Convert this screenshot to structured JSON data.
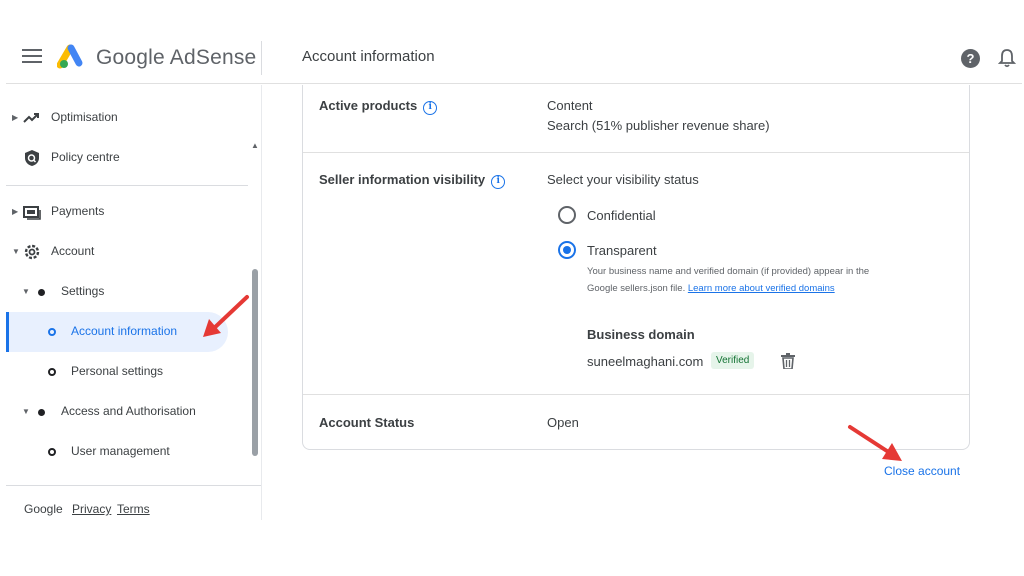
{
  "header": {
    "brand": "Google AdSense",
    "page_title": "Account information",
    "help_glyph": "?"
  },
  "sidebar": {
    "items": [
      {
        "label": "Optimisation",
        "icon": "trending-up-icon"
      },
      {
        "label": "Policy centre",
        "icon": "policy-shield-icon"
      },
      {
        "label": "Payments",
        "icon": "payments-icon"
      },
      {
        "label": "Account",
        "icon": "gear-icon"
      },
      {
        "label": "Settings"
      },
      {
        "label": "Account information",
        "active": true
      },
      {
        "label": "Personal settings"
      },
      {
        "label": "Access and Authorisation"
      },
      {
        "label": "User management"
      }
    ],
    "footer": {
      "google": "Google",
      "privacy": "Privacy",
      "terms": "Terms"
    }
  },
  "main": {
    "active_products": {
      "label": "Active products",
      "values": [
        "Content",
        "Search (51% publisher revenue share)"
      ]
    },
    "seller_visibility": {
      "label": "Seller information visibility",
      "prompt": "Select your visibility status",
      "options": [
        {
          "label": "Confidential",
          "selected": false
        },
        {
          "label": "Transparent",
          "selected": true
        }
      ],
      "helper_line1": "Your business name and verified domain (if provided) appear in the",
      "helper_line2": "Google sellers.json file.",
      "helper_link": "Learn more about verified domains",
      "business_domain_title": "Business domain",
      "domain": "suneelmaghani.com",
      "badge": "Verified"
    },
    "account_status": {
      "label": "Account Status",
      "value": "Open"
    },
    "close_account": "Close account"
  },
  "colors": {
    "accent": "#1a73e8",
    "annotation_arrow": "#e53935",
    "verified_bg": "#e6f4ea"
  }
}
